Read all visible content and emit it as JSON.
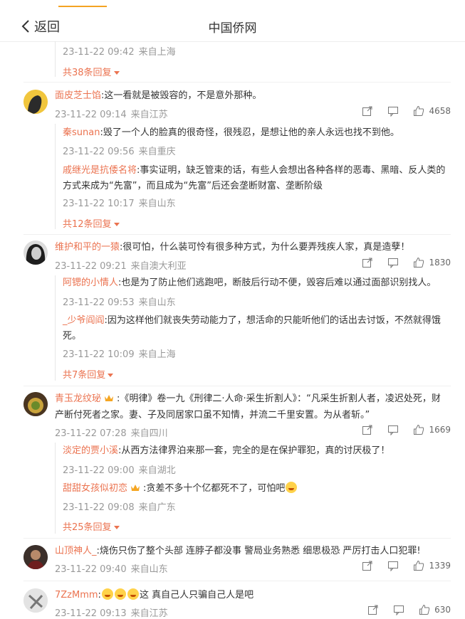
{
  "header": {
    "back_label": "返回",
    "title": "中国侨网"
  },
  "thread0": {
    "reply_meta": {
      "time": "23-11-22 09:42",
      "source": "来自上海"
    },
    "more": "共38条回复"
  },
  "thread1": {
    "user": "面皮芝士馅",
    "text": ":这一看就是被毁容的，不是意外那种。",
    "time": "23-11-22 09:14",
    "source": "来自江苏",
    "likes": "4658",
    "replies": [
      {
        "user": "秦sunan",
        "text": ":毁了一个人的脸真的很奇怪，很残忍，是想让他的亲人永远也找不到他。",
        "time": "23-11-22 09:56",
        "source": "来自重庆"
      },
      {
        "user": "戚继光是抗倭名将",
        "text": ":事实证明，缺乏管束的话，有些人会想出各种各样的恶毒、黑暗、反人类的",
        "text2": "方式来成为“先富”，而且成为“先富”后还会垄断财富、垄断阶级",
        "time": "23-11-22 10:17",
        "source": "来自山东"
      }
    ],
    "more": "共12条回复"
  },
  "thread2": {
    "user": "维护和平的一猿",
    "text": ":很可怕，什么装可怜有很多种方式，为什么要弄残疾人家，真是造孽！",
    "time": "23-11-22 09:21",
    "source": "来自澳大利亚",
    "likes": "1830",
    "replies": [
      {
        "user": "阿锶的小情人",
        "text": ":也是为了防止他们逃跑吧，断肢后行动不便，毁容后难以通过面部识别找人。",
        "time": "23-11-22 09:53",
        "source": "来自山东"
      },
      {
        "user": "_少爷阎阎",
        "text": ":因为这样他们就丧失劳动能力了，想活命的只能听他们的话出去讨饭，不然就得饿",
        "text2": "死。",
        "time": "23-11-22 10:09",
        "source": "来自上海"
      }
    ],
    "more": "共7条回复"
  },
  "thread3": {
    "user": "青玉龙纹珌",
    "text": ":《明律》卷一九《刑律二·人命·采生折割人》：“凡采生折割人者，凌迟处死，财",
    "text2": "产断付死者之家。妻、子及同居家口虽不知情，并流二千里安置。为从者斩。”",
    "time": "23-11-22 07:28",
    "source": "来自四川",
    "likes": "1669",
    "replies": [
      {
        "user": "淡定的贾小溪",
        "text": ":从西方法律界泊来那一套，完全的是在保护罪犯，真的讨厌极了！",
        "time": "23-11-22 09:00",
        "source": "来自湖北"
      },
      {
        "user": "甜甜女孩似初恋",
        "text": ":贪差不多十个亿都死不了，可怕吧",
        "time": "23-11-22 09:08",
        "source": "来自广东"
      }
    ],
    "more": "共25条回复"
  },
  "thread4": {
    "user": "山顶神人_",
    "text": ":烧伤只伤了整个头部 连脖子都没事 警局业务熟悉 细思极恐 严厉打击人口犯罪!",
    "time": "23-11-22 09:40",
    "source": "来自山东",
    "likes": "1339"
  },
  "thread5": {
    "user": "7ZzMmm",
    "text": "这  真自己人只骗自己人是吧",
    "time": "23-11-22 09:13",
    "source": "来自江苏",
    "likes": "630"
  },
  "colors": {
    "accent": "#eb7350",
    "meta": "#999999",
    "tab_indicator": "#f4a323"
  }
}
